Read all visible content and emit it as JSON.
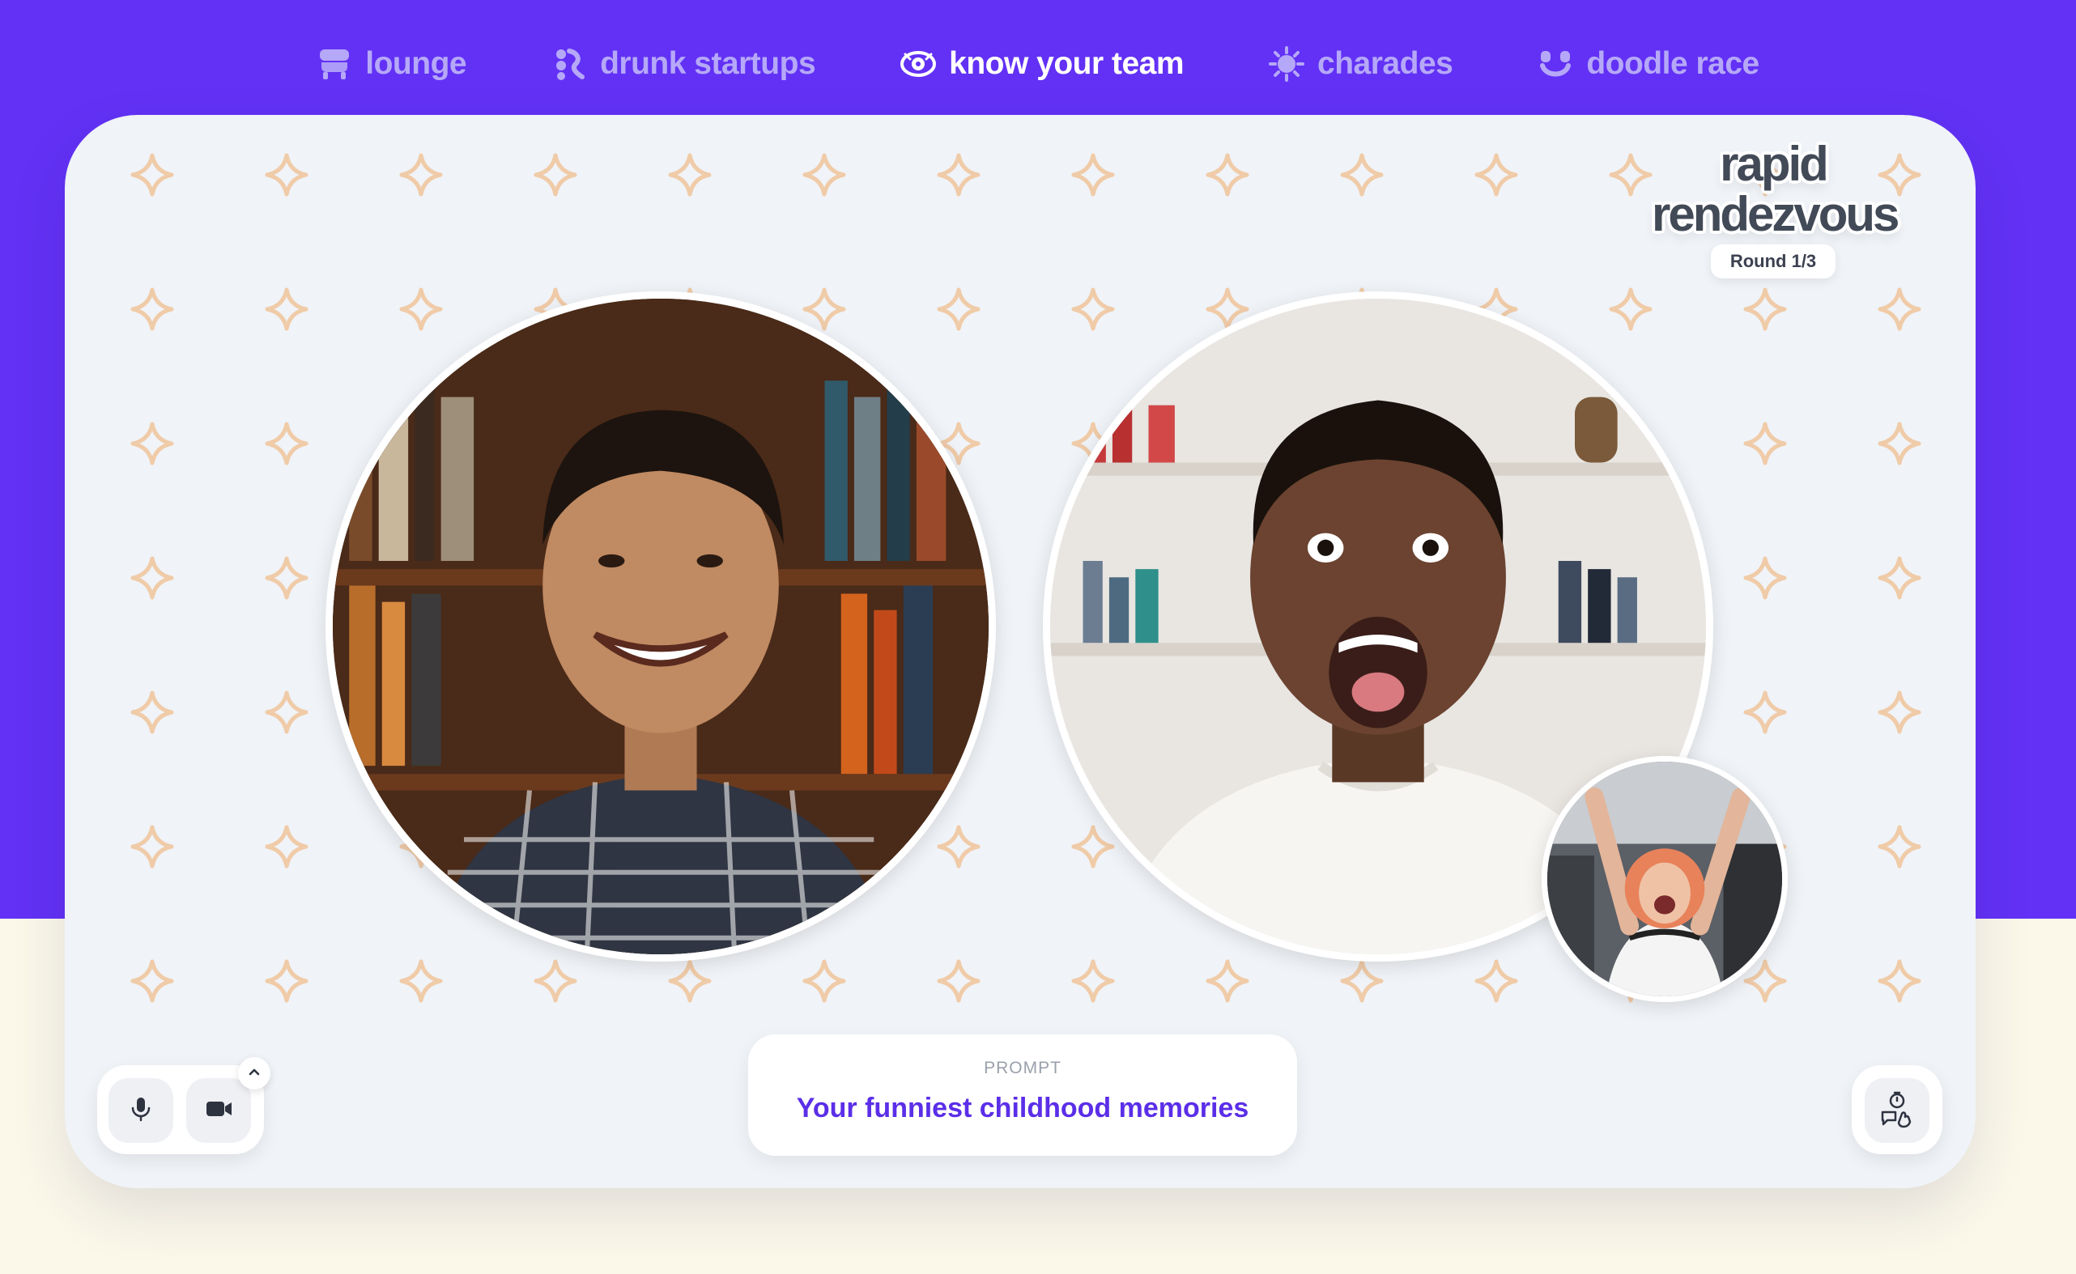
{
  "nav": {
    "items": [
      {
        "label": "lounge",
        "icon": "lounge-icon",
        "active": false
      },
      {
        "label": "drunk startups",
        "icon": "drunk-startups-icon",
        "active": false
      },
      {
        "label": "know your team",
        "icon": "know-your-team-icon",
        "active": true
      },
      {
        "label": "charades",
        "icon": "charades-icon",
        "active": false
      },
      {
        "label": "doodle race",
        "icon": "doodle-race-icon",
        "active": false
      }
    ]
  },
  "game": {
    "title_line1": "rapid",
    "title_line2": "rendezvous",
    "round": "Round 1/3"
  },
  "prompt": {
    "label": "PROMPT",
    "text": "Your funniest childhood memories"
  },
  "controls": {
    "mic_icon": "microphone-icon",
    "camera_icon": "video-camera-icon",
    "expand_icon": "chevron-up-icon",
    "timer_icon": "timer-chat-icon"
  },
  "participants": [
    {
      "role": "remote",
      "description": "man-with-bookshelf"
    },
    {
      "role": "remote",
      "description": "excited-man-shelves"
    },
    {
      "role": "self",
      "description": "woman-arms-raised"
    }
  ],
  "colors": {
    "brand": "#6231f5",
    "accent_text": "#5b2ee8",
    "card_bg": "#f0f3f7",
    "sparkle": "#f0cba8",
    "page_bottom": "#fbf8ea"
  }
}
